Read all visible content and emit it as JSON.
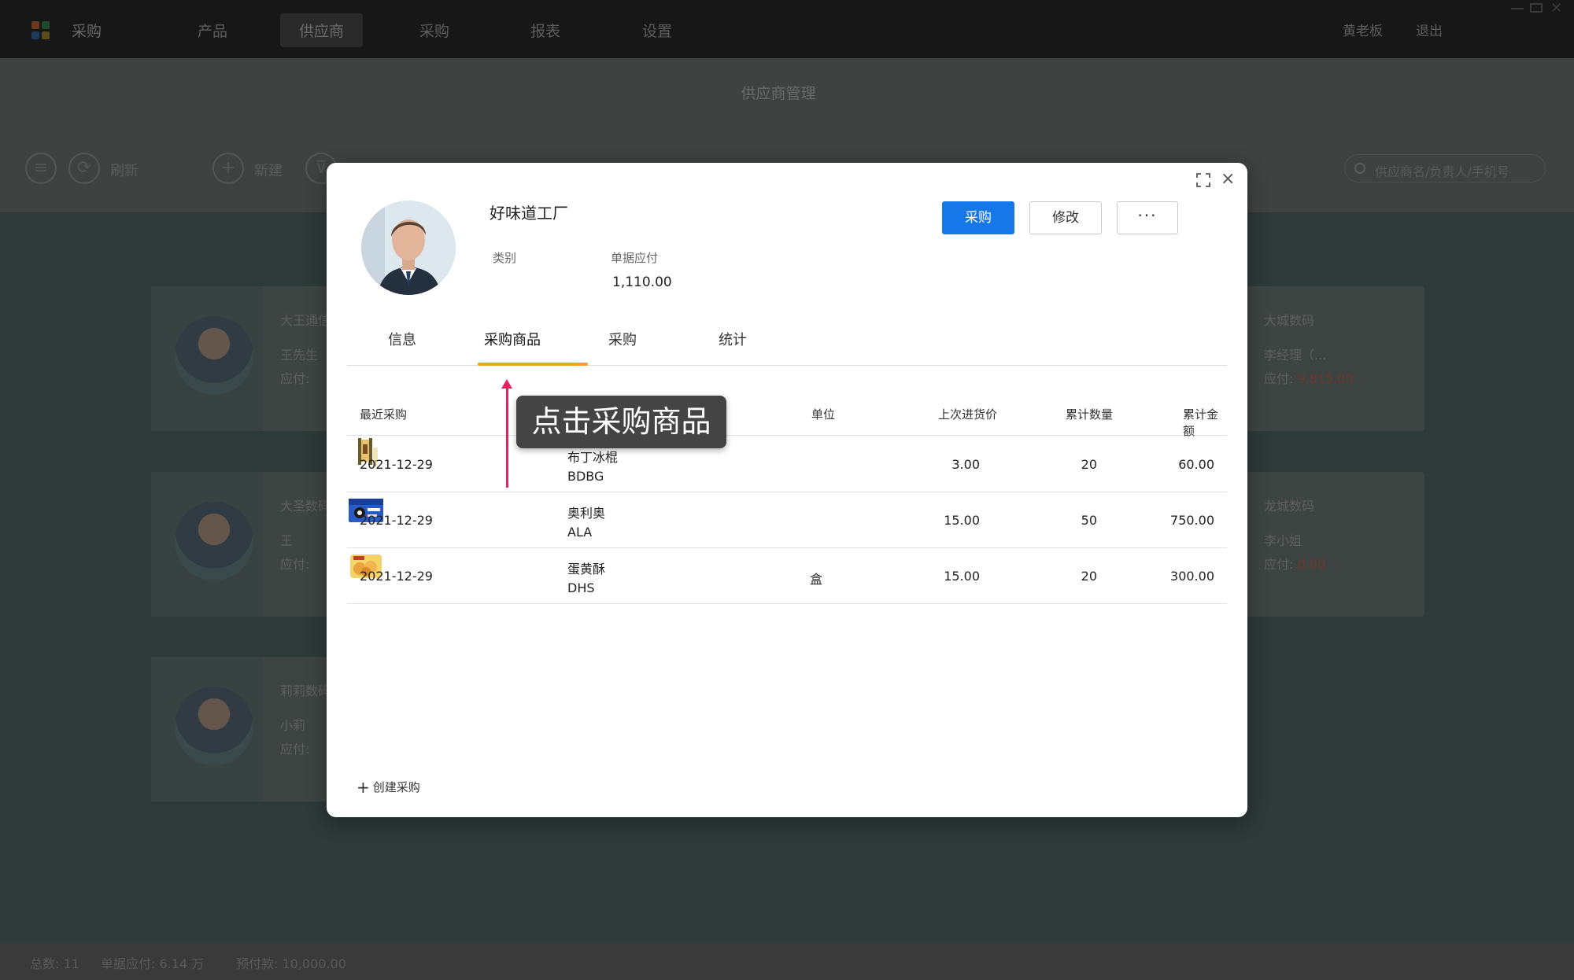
{
  "app": {
    "title": "采购"
  },
  "nav": {
    "items": [
      "产品",
      "供应商",
      "采购",
      "报表",
      "设置"
    ],
    "active": "供应商"
  },
  "top_right": {
    "user": "黄老板",
    "logout": "退出"
  },
  "page": {
    "title": "供应商管理"
  },
  "toolbar": {
    "refresh_label": "刷新",
    "new_label": "新建",
    "search_placeholder": "供应商名/负责人/手机号"
  },
  "cards": [
    {
      "name": "大王通信",
      "contact": "王先生",
      "payable_label": "应付:"
    },
    {
      "name": "大城数码",
      "contact": "李经理（...",
      "payable_label": "应付:",
      "payable_value": "9,815.00"
    },
    {
      "name": "大圣数码",
      "contact": "王",
      "payable_label": "应付:"
    },
    {
      "name": "龙城数码",
      "contact": "李小姐",
      "payable_label": "应付:",
      "payable_value": "0.00"
    },
    {
      "name": "莉莉数码",
      "contact": "小莉",
      "payable_label": "应付:"
    }
  ],
  "footer": {
    "total": "总数:  11",
    "bill_payable": "单据应付:  6.14 万",
    "prepaid": "预付款:  10,000.00"
  },
  "modal": {
    "supplier_name": "好味道工厂",
    "category_label": "类别",
    "bill_payable_label": "单据应付",
    "bill_payable_value": "1,110.00",
    "buttons": {
      "purchase": "采购",
      "edit": "修改",
      "more": "···"
    },
    "tabs": [
      "信息",
      "采购商品",
      "采购",
      "统计"
    ],
    "active_tab": "采购商品",
    "table": {
      "headers": {
        "recent": "最近采购",
        "unit": "单位",
        "last_price": "上次进货价",
        "total_qty": "累计数量",
        "total_amount": "累计金额"
      },
      "rows": [
        {
          "date": "2021-12-29",
          "name": "布丁冰棍",
          "code": "BDBG",
          "unit": "",
          "last_price": "3.00",
          "qty": "20",
          "amount": "60.00",
          "image": "popsicle"
        },
        {
          "date": "2021-12-29",
          "name": "奥利奥",
          "code": "ALA",
          "unit": "",
          "last_price": "15.00",
          "qty": "50",
          "amount": "750.00",
          "image": "cookie-box"
        },
        {
          "date": "2021-12-29",
          "name": "蛋黄酥",
          "code": "DHS",
          "unit": "盒",
          "last_price": "15.00",
          "qty": "20",
          "amount": "300.00",
          "image": "pastry"
        }
      ]
    },
    "create_label": "创建采购"
  },
  "tooltip": {
    "text": "点击采购商品"
  }
}
